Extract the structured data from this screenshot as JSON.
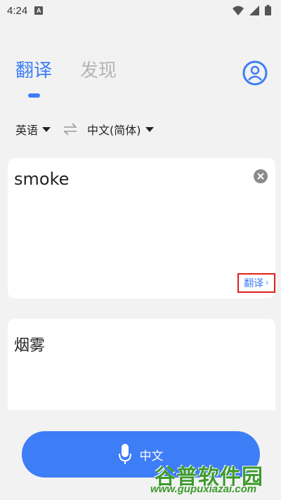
{
  "status_bar": {
    "time": "4:24",
    "notification_badge": "A",
    "icons": [
      "wifi-icon",
      "signal-icon",
      "battery-icon"
    ]
  },
  "tabs": [
    {
      "label": "翻译",
      "active": true
    },
    {
      "label": "发现",
      "active": false
    }
  ],
  "colors": {
    "accent": "#3d7df6",
    "inactive_tab": "#b5b5b5",
    "highlight_box": "#e01f1f",
    "background": "#f2f2f2"
  },
  "languages": {
    "source": "英语",
    "target": "中文(简体)"
  },
  "input": {
    "text": "smoke",
    "translate_label": "翻译",
    "translate_chevron": "›"
  },
  "output": {
    "text": "烟雾"
  },
  "voice": {
    "label": "中文"
  },
  "watermark": {
    "title": "谷普软件园",
    "url": "www.gupuxiazai.com"
  }
}
